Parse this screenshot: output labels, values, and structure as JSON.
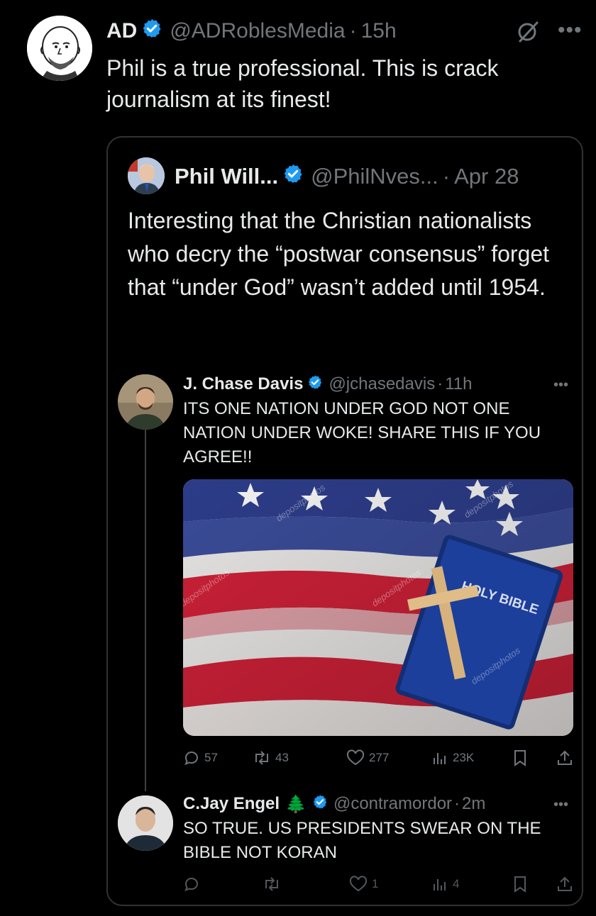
{
  "main_tweet": {
    "author_name": "AD",
    "handle": "@ADRoblesMedia",
    "separator": "·",
    "time": "15h",
    "text": "Phil is a true professional. This is crack journalism at its finest!",
    "more_icon": "more-icon",
    "grok_icon": "grok-icon"
  },
  "quoted_tweet": {
    "author_name": "Phil Will...",
    "handle": "@PhilNves...",
    "separator": "·",
    "date": "Apr 28",
    "text": "Interesting that the Christian nationalists who decry the “postwar consensus” forget that “under God” wasn’t added until 1954."
  },
  "screenshot_thread": {
    "post1": {
      "author_name": "J. Chase Davis",
      "handle": "@jchasedavis",
      "separator": "·",
      "time": "11h",
      "text": "ITS ONE NATION UNDER GOD NOT ONE NATION UNDER WOKE! SHARE THIS IF YOU AGREE!!",
      "image_text": "HOLY BIBLE",
      "watermark": "depositphotos",
      "stats": {
        "replies": "57",
        "reposts": "43",
        "likes": "277",
        "views": "23K"
      }
    },
    "post2": {
      "author_name": "C.Jay Engel",
      "emoji": "🌲",
      "handle": "@contramordor",
      "separator": "·",
      "time": "2m",
      "text": "SO TRUE. US PRESIDENTS SWEAR ON THE BIBLE NOT KORAN",
      "stats": {
        "likes": "1",
        "views": "4"
      }
    }
  },
  "colors": {
    "background": "#000000",
    "text": "#e7e9ea",
    "muted": "#71767b",
    "verified_blue": "#1d9bf0",
    "border": "#2f3336"
  }
}
